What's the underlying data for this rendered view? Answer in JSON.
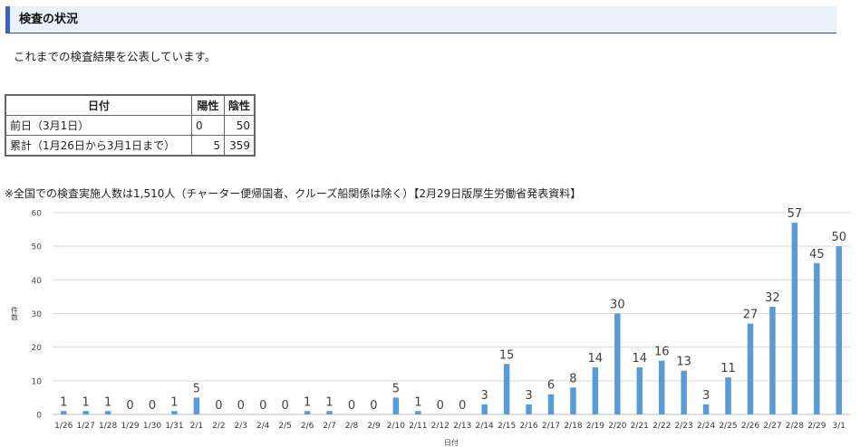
{
  "section": {
    "title": "検査の状況"
  },
  "intro": "これまでの検査結果を公表しています。",
  "table": {
    "headers": [
      "日付",
      "陽性",
      "陰性"
    ],
    "rows": [
      {
        "label": "前日（3月1日）",
        "positive": "0",
        "negative": "50"
      },
      {
        "label": "累計（1月26日から3月1日まで）",
        "positive": "5",
        "negative": "359"
      }
    ]
  },
  "note": "※全国での検査実施人数は1,510人（チャーター便帰国者、クルーズ船関係は除く）【2月29日版厚生労働省発表資料】",
  "chart_data": {
    "type": "bar",
    "title": "",
    "xlabel": "日付",
    "ylabel": "件数",
    "ylim": [
      0,
      60
    ],
    "yticks": [
      0,
      10,
      20,
      30,
      40,
      50,
      60
    ],
    "grid": true,
    "bar_color": "#5b9bd5",
    "categories": [
      "1/26",
      "1/27",
      "1/28",
      "1/29",
      "1/30",
      "1/31",
      "2/1",
      "2/2",
      "2/3",
      "2/4",
      "2/5",
      "2/6",
      "2/7",
      "2/8",
      "2/9",
      "2/10",
      "2/11",
      "2/12",
      "2/13",
      "2/14",
      "2/15",
      "2/16",
      "2/17",
      "2/18",
      "2/19",
      "2/20",
      "2/21",
      "2/22",
      "2/23",
      "2/24",
      "2/25",
      "2/26",
      "2/27",
      "2/28",
      "2/29",
      "3/1"
    ],
    "values": [
      1,
      1,
      1,
      0,
      0,
      1,
      5,
      0,
      0,
      0,
      0,
      1,
      1,
      0,
      0,
      5,
      1,
      0,
      0,
      3,
      15,
      3,
      6,
      8,
      14,
      30,
      14,
      16,
      13,
      3,
      11,
      27,
      32,
      57,
      45,
      50
    ]
  }
}
